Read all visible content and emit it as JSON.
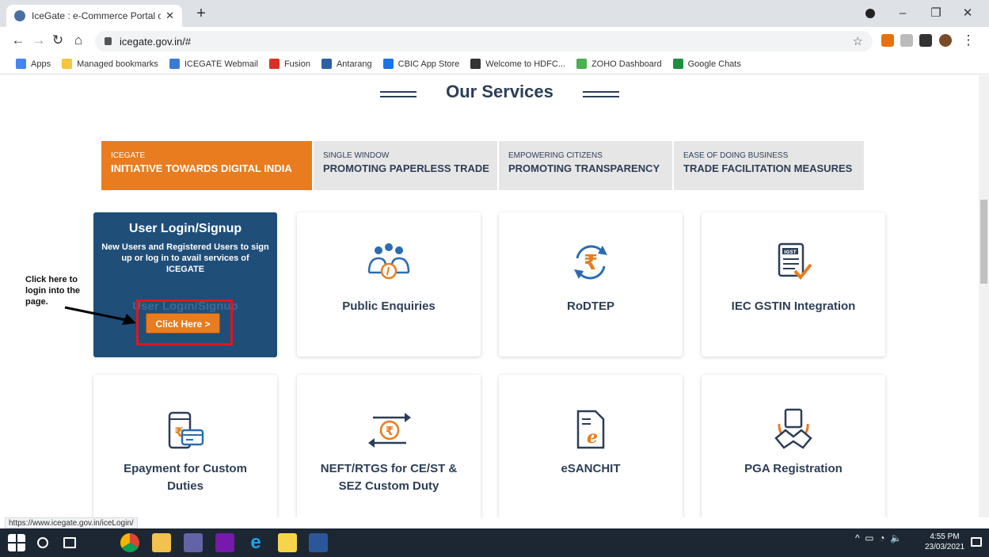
{
  "browser": {
    "tab_title": "IceGate : e-Commerce Portal of C",
    "url": "icegate.gov.in/#",
    "status_url": "https://www.icegate.gov.in/iceLogin/",
    "bookmarks": [
      {
        "label": "Apps",
        "color": "#4285f4"
      },
      {
        "label": "Managed bookmarks",
        "color": "#f4c542"
      },
      {
        "label": "ICEGATE Webmail",
        "color": "#3a7bd5"
      },
      {
        "label": "Fusion",
        "color": "#d93025"
      },
      {
        "label": "Antarang",
        "color": "#2e5fa3"
      },
      {
        "label": "CBIC App Store",
        "color": "#1a73e8"
      },
      {
        "label": "Welcome to HDFC...",
        "color": "#333333"
      },
      {
        "label": "ZOHO Dashboard",
        "color": "#4caf50"
      },
      {
        "label": "Google Chats",
        "color": "#1e8e3e"
      }
    ]
  },
  "page": {
    "section_title": "Our Services",
    "tabs": [
      {
        "small": "ICEGATE",
        "big": "INITIATIVE TOWARDS DIGITAL INDIA"
      },
      {
        "small": "SINGLE WINDOW",
        "big": "PROMOTING PAPERLESS TRADE"
      },
      {
        "small": "EMPOWERING CITIZENS",
        "big": "PROMOTING TRANSPARENCY"
      },
      {
        "small": "EASE OF DOING BUSINESS",
        "big": "TRADE FACILITATION MEASURES"
      }
    ],
    "login_card": {
      "heading": "User Login/Signup",
      "description": "New Users and Registered Users to sign up or log in to avail services of ICEGATE",
      "ghost_label": "User Login/Signup",
      "button": "Click Here >"
    },
    "annotation": "Click here to login into the page.",
    "services": [
      {
        "label": "Public Enquiries",
        "icon": "people-icon"
      },
      {
        "label": "RoDTEP",
        "icon": "rupee-refresh-icon"
      },
      {
        "label": "IEC GSTIN Integration",
        "icon": "gst-document-icon"
      },
      {
        "label": "Epayment for Custom Duties",
        "icon": "phone-payment-icon"
      },
      {
        "label": "NEFT/RTGS for CE/ST & SEZ Custom Duty",
        "icon": "rupee-transfer-icon"
      },
      {
        "label": "eSANCHIT",
        "icon": "e-document-icon"
      },
      {
        "label": "PGA Registration",
        "icon": "handshake-icon"
      }
    ]
  },
  "taskbar": {
    "time": "4:55 PM",
    "date": "23/03/2021"
  },
  "colors": {
    "accent": "#e87c1e",
    "navy": "#1f4e79",
    "text": "#2c3e57"
  }
}
